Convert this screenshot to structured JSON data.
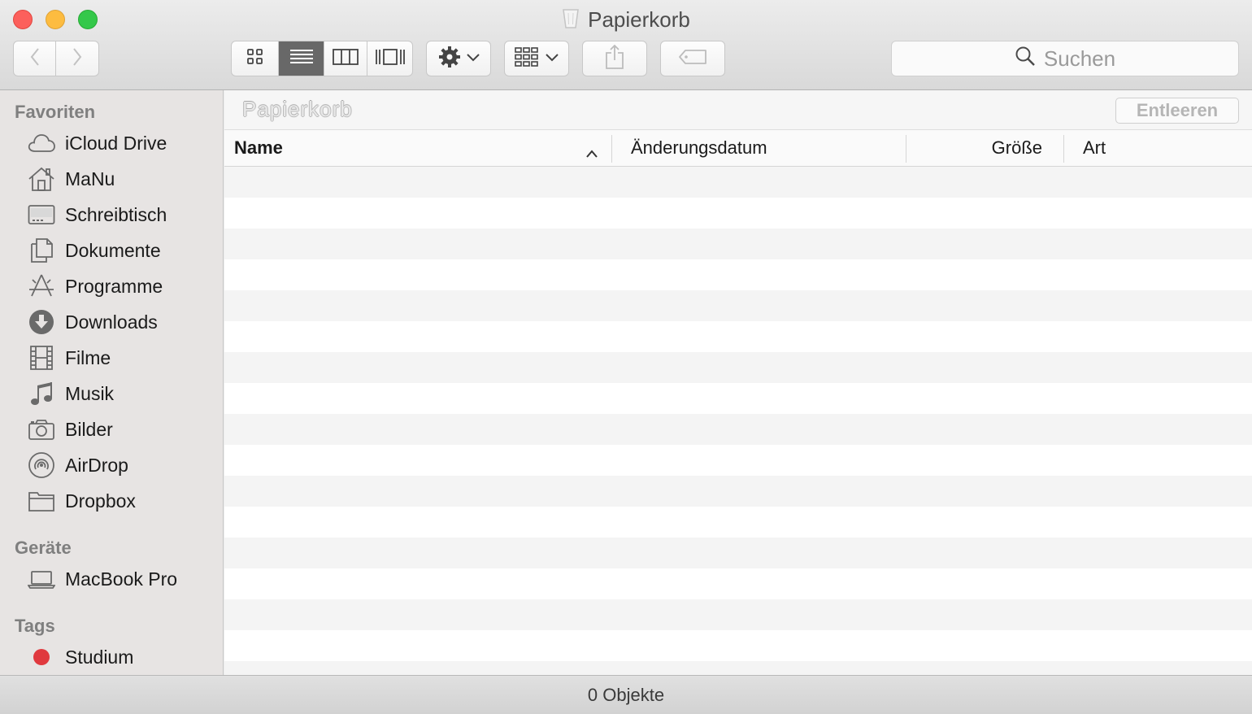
{
  "window": {
    "title": "Papierkorb"
  },
  "toolbar": {
    "back": "chevron-left-icon",
    "forward": "chevron-right-icon",
    "view_modes": [
      "icon-view-icon",
      "list-view-icon",
      "column-view-icon",
      "coverflow-view-icon"
    ],
    "active_view": "list-view-icon",
    "search_placeholder": "Suchen"
  },
  "sidebar": {
    "favorites_header": "Favoriten",
    "favorites": [
      {
        "label": "iCloud Drive",
        "icon": "cloud-icon"
      },
      {
        "label": "MaNu",
        "icon": "home-icon"
      },
      {
        "label": "Schreibtisch",
        "icon": "desktop-icon"
      },
      {
        "label": "Dokumente",
        "icon": "documents-icon"
      },
      {
        "label": "Programme",
        "icon": "applications-icon"
      },
      {
        "label": "Downloads",
        "icon": "downloads-icon"
      },
      {
        "label": "Filme",
        "icon": "film-icon"
      },
      {
        "label": "Musik",
        "icon": "music-icon"
      },
      {
        "label": "Bilder",
        "icon": "camera-icon"
      },
      {
        "label": "AirDrop",
        "icon": "airdrop-icon"
      },
      {
        "label": "Dropbox",
        "icon": "folder-icon"
      }
    ],
    "devices_header": "Geräte",
    "devices": [
      {
        "label": "MacBook Pro",
        "icon": "laptop-icon"
      }
    ],
    "tags_header": "Tags",
    "tags": [
      {
        "label": "Studium",
        "color": "#e0393e"
      }
    ]
  },
  "main": {
    "path_label": "Papierkorb",
    "empty_button": "Entleeren",
    "columns": {
      "name": "Name",
      "date": "Änderungsdatum",
      "size": "Größe",
      "kind": "Art"
    }
  },
  "status": {
    "text": "0 Objekte"
  },
  "colors": {
    "accent_active_segment": "#686868",
    "close": "#fc605c",
    "minimize": "#fdbc40",
    "maximize": "#34c84a"
  }
}
